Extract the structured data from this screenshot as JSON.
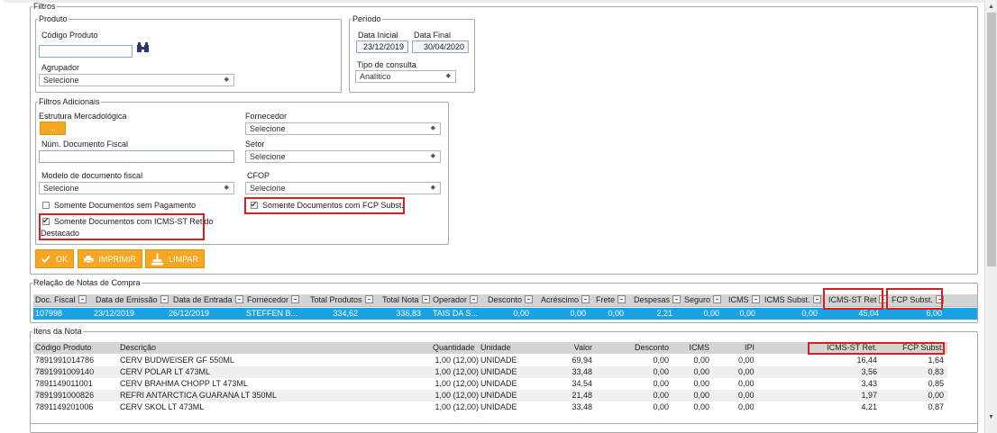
{
  "filtros_legend": "Filtros",
  "produto": {
    "legend": "Produto",
    "codigo_label": "Código Produto",
    "codigo_value": "",
    "agrupador_label": "Agrupador",
    "agrupador_value": "Selecione"
  },
  "periodo": {
    "legend": "Período",
    "data_inicial_label": "Data Inicial",
    "data_inicial_value": "23/12/2019",
    "data_final_label": "Data Final",
    "data_final_value": "30/04/2020",
    "tipo_label": "Tipo de consulta",
    "tipo_value": "Analítico"
  },
  "adicionais": {
    "legend": "Filtros Adicionais",
    "estrutura_label": "Estrutura Mercadológica",
    "estrutura_btn": "...",
    "fornecedor_label": "Fornecedor",
    "fornecedor_value": "Selecione",
    "num_doc_label": "Núm. Documento Fiscal",
    "num_doc_value": "",
    "setor_label": "Setor",
    "setor_value": "Selecione",
    "modelo_label": "Modelo de documento fiscal",
    "modelo_value": "Selecione",
    "cfop_label": "CFOP",
    "cfop_value": "Selecione",
    "chk_sem_pagamento": "Somente Documentos sem Pagamento",
    "chk_icms_st_line1": "Somente Documentos com ICMS-ST Retido",
    "chk_icms_st_line2": "Destacado",
    "chk_fcp": "Somente Documentos com FCP Subst."
  },
  "buttons": {
    "ok": "OK",
    "imprimir": "IMPRIMIR",
    "limpar": "LIMPAR"
  },
  "relacao": {
    "legend": "Relação de Notas de Compra",
    "headers": [
      "Doc. Fiscal",
      "Data de Emissão",
      "Data de Entrada",
      "Fornecedor",
      "Total Produtos",
      "Total Nota",
      "Operador",
      "Desconto",
      "Acréscimo",
      "Frete",
      "Despesas",
      "Seguro",
      "ICMS",
      "ICMS Subst.",
      "ICMS-ST Ret",
      "FCP Subst."
    ],
    "rows": [
      [
        "107998",
        "23/12/2019",
        "26/12/2019",
        "STEFFEN B...",
        "334,62",
        "336,83",
        "TAIS DA S...",
        "0,00",
        "0,00",
        "0,00",
        "2,21",
        "0,00",
        "0,00",
        "0,00",
        "45,04",
        "6,00"
      ]
    ]
  },
  "itens": {
    "legend": "Itens da Nota",
    "headers": [
      "Código Produto",
      "Descrição",
      "Quantidade",
      "Unidade",
      "Valor",
      "Desconto",
      "ICMS",
      "IPI",
      "ICMS-ST Ret.",
      "FCP Subst."
    ],
    "rows": [
      [
        "7891991014786",
        "CERV BUDWEISER GF 550ML",
        "1,00 (12,00)",
        "UNIDADE",
        "69,94",
        "0,00",
        "0,00",
        "0,00",
        "16,44",
        "1,64"
      ],
      [
        "7891991009140",
        "CERV POLAR LT 473ML",
        "1,00 (12,00)",
        "UNIDADE",
        "33,48",
        "0,00",
        "0,00",
        "0,00",
        "3,56",
        "0,83"
      ],
      [
        "7891149011001",
        "CERV BRAHMA CHOPP LT 473ML",
        "1,00 (12,00)",
        "UNIDADE",
        "34,54",
        "0,00",
        "0,00",
        "0,00",
        "3,43",
        "0,85"
      ],
      [
        "7891991000826",
        "REFRI ANTARCTICA GUARANA LT 350ML",
        "1,00 (12,00)",
        "UNIDADE",
        "21,48",
        "0,00",
        "0,00",
        "0,00",
        "1,97",
        "0,00"
      ],
      [
        "7891149201006",
        "CERV SKOL LT 473ML",
        "1,00 (12,00)",
        "UNIDADE",
        "33,48",
        "0,00",
        "0,00",
        "0,00",
        "4,21",
        "0,87"
      ]
    ]
  },
  "colors": {
    "accent": "#f5a623",
    "selected_row": "#18a3e6",
    "highlight": "#d61f1f",
    "header_bg": "#d4d4d4"
  }
}
